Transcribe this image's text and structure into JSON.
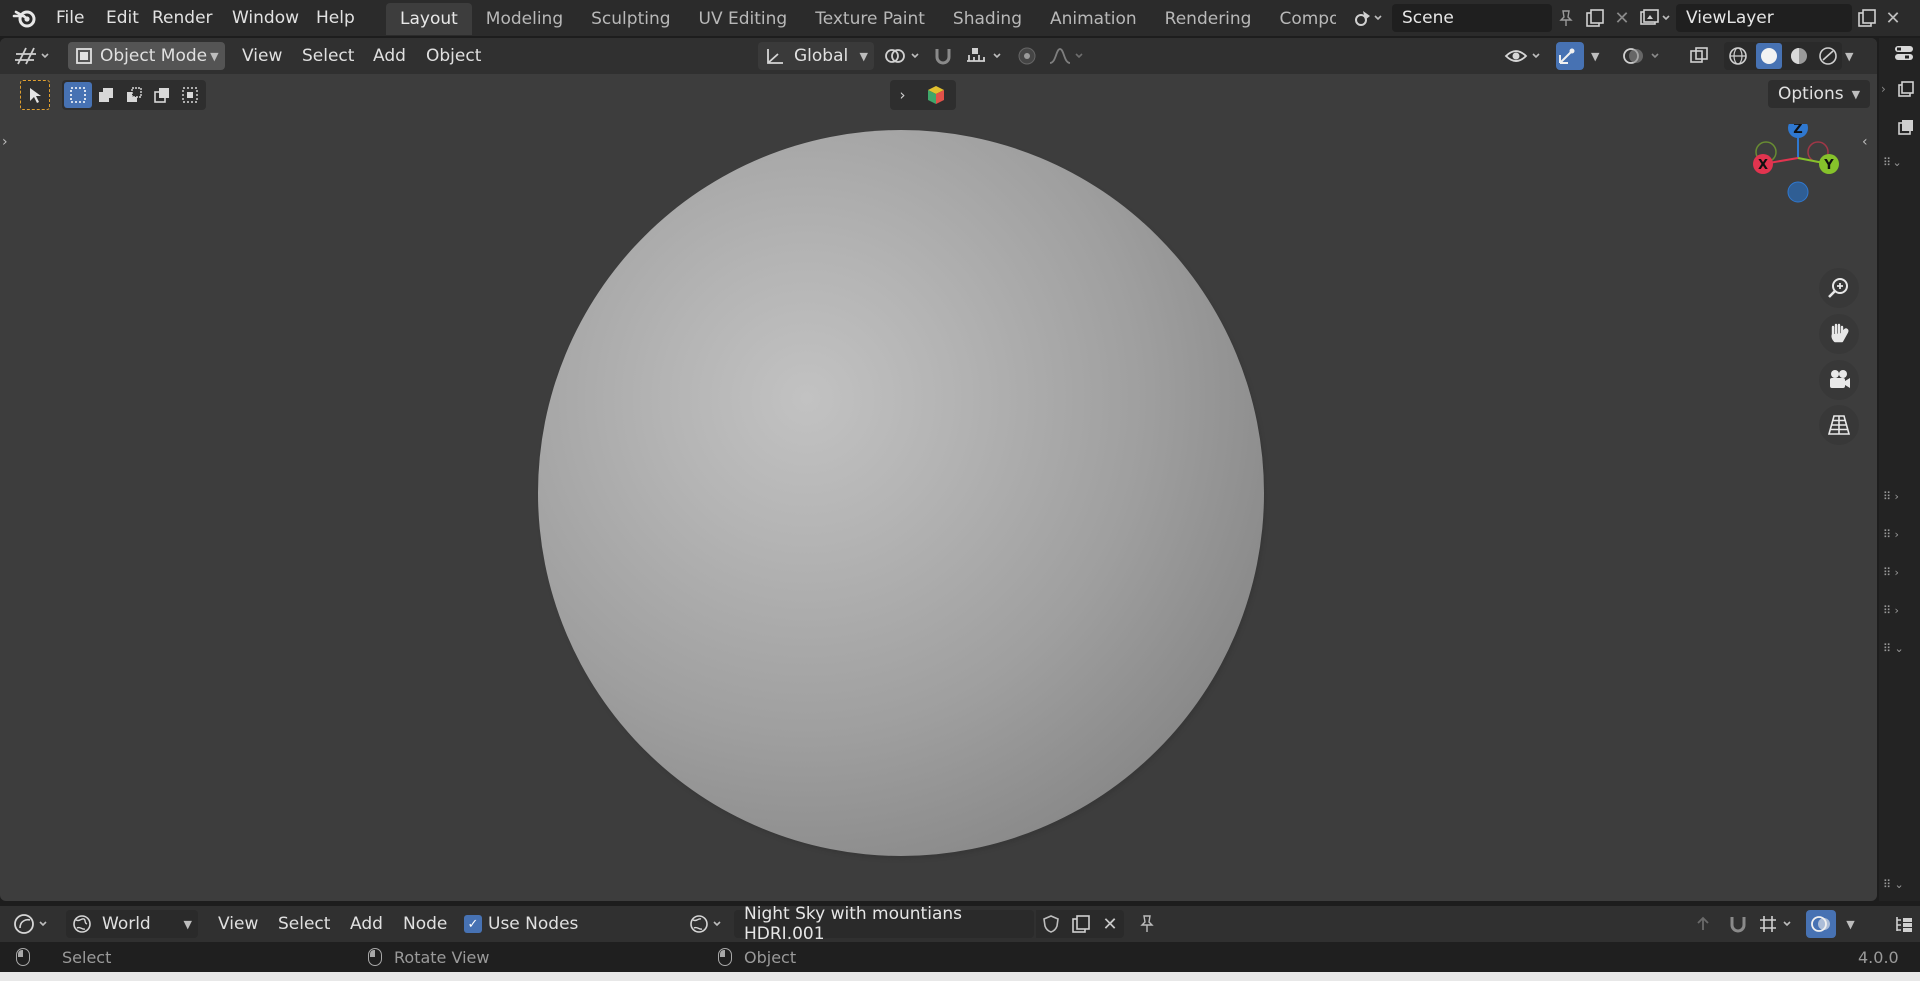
{
  "app": {
    "menus": [
      "File",
      "Edit",
      "Render",
      "Window",
      "Help"
    ],
    "workspaces": [
      "Layout",
      "Modeling",
      "Sculpting",
      "UV Editing",
      "Texture Paint",
      "Shading",
      "Animation",
      "Rendering",
      "Compositing"
    ],
    "active_workspace": "Layout",
    "scene_name": "Scene",
    "view_layer": "ViewLayer"
  },
  "viewport_header": {
    "mode": "Object Mode",
    "menus": [
      "View",
      "Select",
      "Add",
      "Object"
    ],
    "orientation": "Global",
    "options_label": "Options"
  },
  "gizmo": {
    "x_label": "X",
    "y_label": "Y",
    "z_label": "Z",
    "x_color": "#e2344f",
    "y_color": "#86c22b",
    "z_color": "#2f78d0"
  },
  "node_header": {
    "world_label": "World",
    "menus": [
      "View",
      "Select",
      "Add",
      "Node"
    ],
    "use_nodes_label": "Use Nodes",
    "use_nodes_checked": true,
    "world_name": "Night Sky with mountians HDRI.001"
  },
  "status_bar": {
    "select": "Select",
    "rotate": "Rotate View",
    "object": "Object",
    "version": "4.0.0"
  },
  "colors": {
    "accent_blue": "#4772b3",
    "viewport_bg": "#3d3d3d",
    "header_bg": "#303030"
  }
}
